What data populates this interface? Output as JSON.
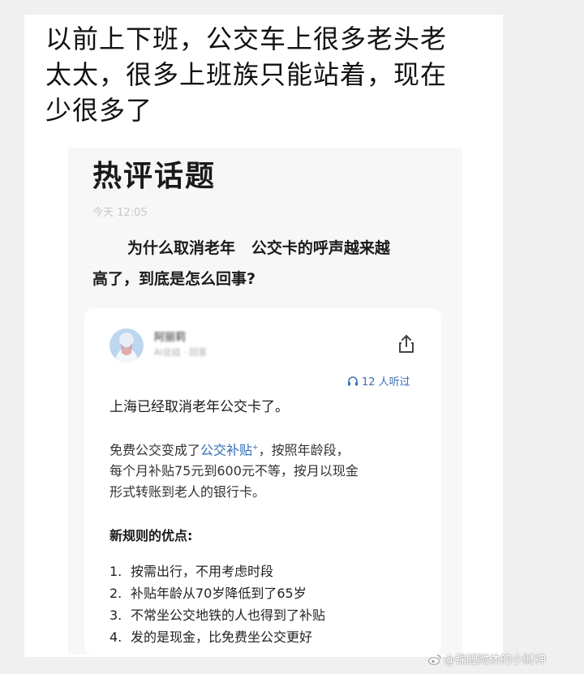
{
  "post": {
    "caption_lines": [
      "以前上下班，公交车上很多老头老",
      "太太，很多上班族只能站着，现在",
      "少很多了"
    ]
  },
  "screenshot": {
    "section_title": "热评话题",
    "timestamp": "今天 12:05",
    "question_line1": "为什么取消老年   公交卡的呼声越来越",
    "question_line2": "高了，到底是怎么回事?",
    "answer": {
      "author_name": "阿丽莉",
      "author_subtitle": "AI总结 · 回答",
      "share_icon": "share-icon",
      "listen_icon": "headphones-icon",
      "listen_count": "12 人听过",
      "lead": "上海已经取消老年公交卡了。",
      "para_prefix": "免费公交变成了",
      "para_link": "公交补贴",
      "para_sup": "+",
      "para_line1_rest": "，按照年龄段，",
      "para_line2": "每个月补贴75元到600元不等，按月以现金",
      "para_line3": "形式转账到老人的银行卡。",
      "advantages_heading": "新规则的优点:",
      "advantages": [
        {
          "num": "1.",
          "text": "按需出行，不用考虑时段"
        },
        {
          "num": "2.",
          "text": "补贴年龄从70岁降低到了65岁"
        },
        {
          "num": "3.",
          "text": "不常坐公交地铁的人也得到了补贴"
        },
        {
          "num": "4.",
          "text": "发的是现金，比免费坐公交更好"
        }
      ]
    }
  },
  "watermark": {
    "icon": "weibo-icon",
    "text": "@锦鲤附体的小财神"
  },
  "colors": {
    "link": "#2f6db7",
    "listen": "#3b6fb6",
    "page_background": "#f0f0f0"
  }
}
